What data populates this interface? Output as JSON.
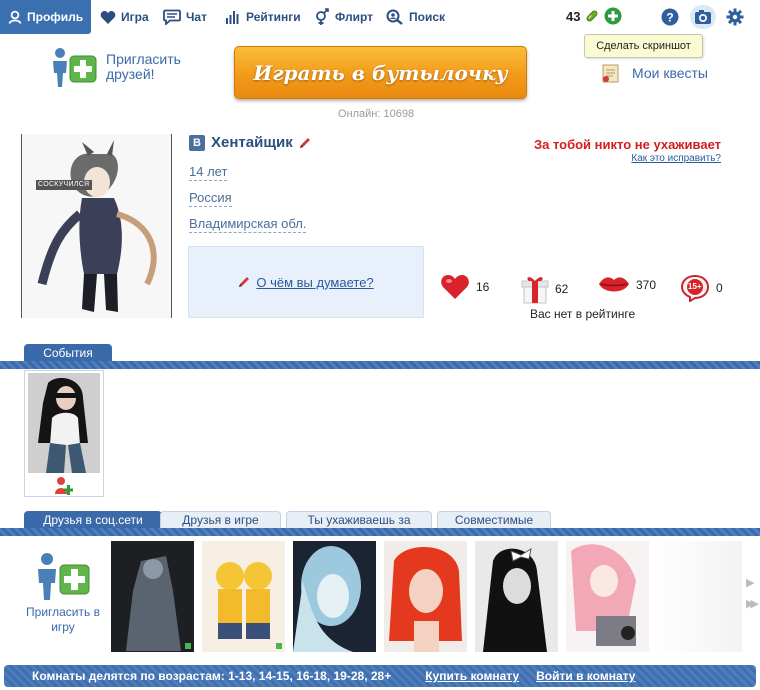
{
  "nav": {
    "items": [
      {
        "label": "Профиль",
        "icon": "profile-icon"
      },
      {
        "label": "Игра",
        "icon": "heart-icon"
      },
      {
        "label": "Чат",
        "icon": "chat-icon"
      },
      {
        "label": "Рейтинги",
        "icon": "chart-bars-icon"
      },
      {
        "label": "Флирт",
        "icon": "gender-icon"
      },
      {
        "label": "Поиск",
        "icon": "search-icon"
      }
    ],
    "active": "Профиль",
    "coins": "43",
    "tooltip": "Сделать скриншот"
  },
  "promo": {
    "invite_friends": "Пригласить друзей!",
    "play_button": "Играть в бутылочку",
    "online": "Онлайн: 10698",
    "quests": "Мои квесты"
  },
  "profile": {
    "network_badge": "В",
    "name": "Хентайщик",
    "avatar_caption": "СОСКУЧИЛСЯ",
    "age": "14 лет",
    "country": "Россия",
    "region": "Владимирская обл.",
    "status_prompt": "О чём вы думаете?",
    "admirer_status": "За тобой никто не ухаживает",
    "how_to_fix": "Как это исправить?",
    "stats": [
      {
        "icon": "heart-icon",
        "value": "16"
      },
      {
        "icon": "gift-icon",
        "value": "62"
      },
      {
        "icon": "lips-icon",
        "value": "370"
      },
      {
        "icon": "age-limit-icon",
        "value": "0",
        "badge": "15+"
      }
    ],
    "rating_note": "Вас нет в рейтинге"
  },
  "events": {
    "tab": "События"
  },
  "friends": {
    "tabs": [
      "Друзья в соц.сети",
      "Друзья в игре",
      "Ты ухаживаешь за",
      "Совместимые"
    ],
    "active_tab": "Друзья в соц.сети",
    "invite_game": "Пригласить в игру"
  },
  "bottom": {
    "rooms": "Комнаты делятся по возрастам: 1-13, 14-15, 16-18, 19-28, 28+",
    "buy_room": "Купить комнату",
    "enter_room": "Войти в комнату"
  },
  "colors": {
    "accent": "#3a6aaa",
    "link": "#2a5a9c",
    "alert": "#d21e1e",
    "play_button": "#f39a1a"
  }
}
